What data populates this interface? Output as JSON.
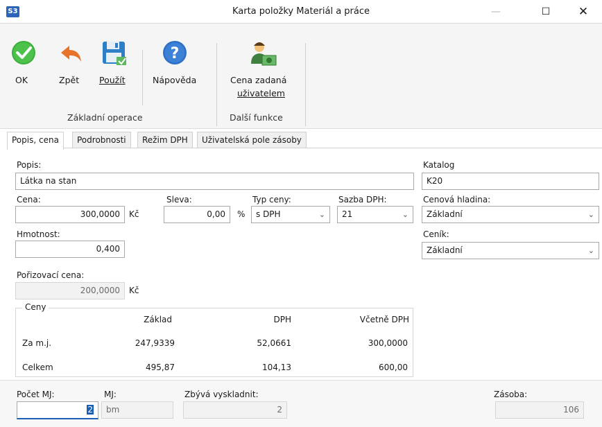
{
  "window": {
    "app_icon_text": "S3",
    "title": "Karta položky Materiál a práce",
    "minimize_glyph": "—",
    "maximize_glyph": "☐",
    "close_glyph": "✕"
  },
  "toolbar": {
    "ok_label": "OK",
    "back_label": "Zpět",
    "apply_label": "Použít",
    "help_label": "Nápověda",
    "user_price_label_line1": "Cena zadaná",
    "user_price_label_line2": "uživatelem",
    "group_basic": "Základní operace",
    "group_more": "Další funkce",
    "icons": [
      "check-icon",
      "undo-arrow-icon",
      "save-icon",
      "help-icon",
      "user-price-icon"
    ]
  },
  "tabs": [
    {
      "label": "Popis, cena",
      "active": true
    },
    {
      "label": "Podrobnosti",
      "active": false
    },
    {
      "label": "Režim DPH",
      "active": false
    },
    {
      "label": "Uživatelská pole zásoby",
      "active": false
    }
  ],
  "form": {
    "popis_label": "Popis:",
    "popis_value": "Látka na stan",
    "cena_label": "Cena:",
    "cena_value": "300,0000",
    "cena_unit": "Kč",
    "sleva_label": "Sleva:",
    "sleva_value": "0,00",
    "sleva_unit": "%",
    "typ_ceny_label": "Typ ceny:",
    "typ_ceny_value": "s DPH",
    "sazba_dph_label": "Sazba DPH:",
    "sazba_dph_value": "21",
    "hmotnost_label": "Hmotnost:",
    "hmotnost_value": "0,400",
    "porizovaci_label": "Pořizovací cena:",
    "porizovaci_value": "200,0000",
    "porizovaci_unit": "Kč",
    "katalog_label": "Katalog",
    "katalog_value": "K20",
    "cenova_hladina_label": "Cenová hladina:",
    "cenova_hladina_value": "Základní",
    "cenik_label": "Ceník:",
    "cenik_value": "Základní"
  },
  "ceny": {
    "title": "Ceny",
    "headers": [
      "Základ",
      "DPH",
      "Včetně DPH"
    ],
    "rows": [
      {
        "label": "Za m.j.",
        "zaklad": "247,9339",
        "dph": "52,0661",
        "vcetne": "300,0000"
      },
      {
        "label": "Celkem",
        "zaklad": "495,87",
        "dph": "104,13",
        "vcetne": "600,00"
      }
    ]
  },
  "bottom": {
    "pocet_label": "Počet MJ:",
    "pocet_value": "2",
    "mj_label": "MJ:",
    "mj_value": "bm",
    "zbyva_label": "Zbývá vyskladnit:",
    "zbyva_value": "2",
    "zasoba_label": "Zásoba:",
    "zasoba_value": "106"
  },
  "colors": {
    "ok_green": "#3cae3c",
    "back_orange": "#e8732a",
    "help_blue": "#2d6fc4",
    "app_blue": "#2b64b8"
  }
}
